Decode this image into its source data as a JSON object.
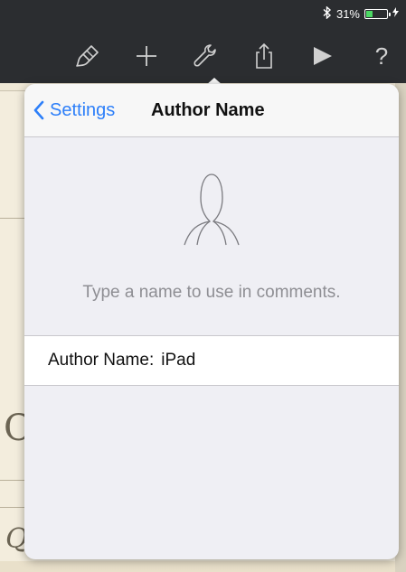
{
  "status": {
    "bluetooth_icon": "bluetooth-icon",
    "battery_percent": "31%",
    "battery_level": 0.31,
    "charging_icon": "charging-bolt-icon"
  },
  "toolbar": {
    "icons": [
      "paintbrush-icon",
      "plus-icon",
      "wrench-icon",
      "share-icon",
      "play-icon",
      "help-icon"
    ],
    "help_glyph": "?"
  },
  "popover": {
    "back_label": "Settings",
    "title": "Author Name",
    "avatar_icon": "person-silhouette-icon",
    "hint": "Type a name to use in comments.",
    "field_label": "Author Name:",
    "field_value": "iPad"
  },
  "colors": {
    "accent": "#2d7ff9",
    "battery_fill": "#4cd964"
  }
}
